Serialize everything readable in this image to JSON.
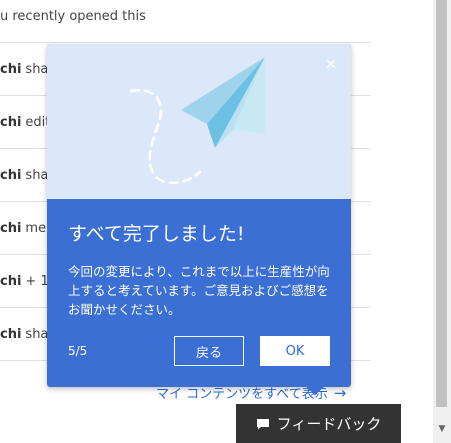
{
  "activity": {
    "header_text": "u recently opened this",
    "rows": [
      {
        "user": "chi",
        "action": "shar"
      },
      {
        "user": "chi",
        "action": "edit"
      },
      {
        "user": "chi",
        "action": "shar"
      },
      {
        "user": "chi",
        "action": "men"
      },
      {
        "user": "chi",
        "action": "+ 1"
      },
      {
        "user": "chi",
        "action": "shar"
      }
    ]
  },
  "see_all_link": {
    "label": "マイ コンテンツをすべて表示",
    "arrow": "→"
  },
  "feedback": {
    "label": "フィードバック",
    "icon": "speech-bubble-icon"
  },
  "callout": {
    "illustration_icon": "paper-plane-icon",
    "close_icon": "close-icon",
    "close_glyph": "✕",
    "title": "すべて完了しました!",
    "body": "今回の変更により、これまで以上に生産性が向上すると考えています。ご意見およびご感想をお聞かせください。",
    "step": "5/5",
    "back_label": "戻る",
    "ok_label": "OK"
  },
  "colors": {
    "callout_bg": "#3b6fd4",
    "illustration_bg": "#dae8f9",
    "link": "#2b6fd6",
    "feedback_bg": "#333333"
  }
}
